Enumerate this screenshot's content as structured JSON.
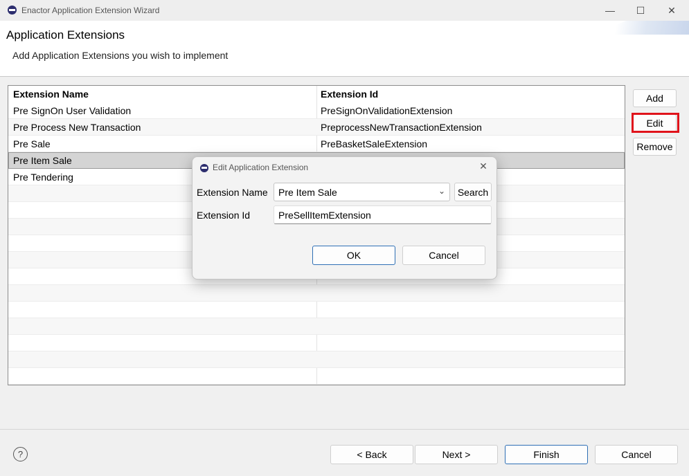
{
  "window": {
    "title": "Enactor Application Extension Wizard",
    "minimize_glyph": "—",
    "maximize_glyph": "☐",
    "close_glyph": "✕"
  },
  "header": {
    "title": "Application Extensions",
    "description": "Add Application Extensions you wish to implement"
  },
  "table": {
    "columns": [
      "Extension Name",
      "Extension Id"
    ],
    "rows": [
      {
        "name": "Pre SignOn User Validation",
        "id": "PreSignOnValidationExtension"
      },
      {
        "name": "Pre Process New Transaction",
        "id": "PreprocessNewTransactionExtension"
      },
      {
        "name": "Pre Sale",
        "id": "PreBasketSaleExtension"
      },
      {
        "name": "Pre Item Sale",
        "id": ""
      },
      {
        "name": "Pre Tendering",
        "id": ""
      }
    ],
    "selected_row": 3
  },
  "side_buttons": {
    "add": "Add",
    "edit": "Edit",
    "remove": "Remove"
  },
  "footer": {
    "help_glyph": "?",
    "back": "< Back",
    "next": "Next >",
    "finish": "Finish",
    "cancel": "Cancel"
  },
  "dialog": {
    "title": "Edit Application Extension",
    "close_glyph": "✕",
    "extension_name_label": "Extension Name",
    "extension_name_value": "Pre Item Sale",
    "dropdown_glyph": "⌄",
    "search_label": "Search",
    "extension_id_label": "Extension Id",
    "extension_id_value": "PreSellItemExtension",
    "ok": "OK",
    "cancel": "Cancel"
  },
  "colors": {
    "highlight": "#e0131b",
    "selected_row": "#d4d4d4",
    "primary_border": "#2e6fb5"
  }
}
